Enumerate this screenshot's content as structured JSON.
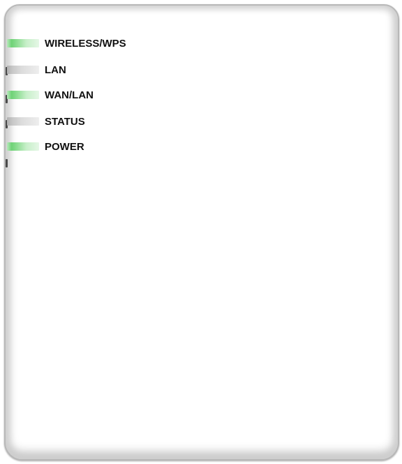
{
  "indicators": [
    {
      "label": "WIRELESS/WPS",
      "state": "on",
      "color": "#6fd277"
    },
    {
      "label": "LAN",
      "state": "off",
      "color": "#c8c8c8"
    },
    {
      "label": "WAN/LAN",
      "state": "on",
      "color": "#6fd277"
    },
    {
      "label": "STATUS",
      "state": "off",
      "color": "#c8c8c8"
    },
    {
      "label": "POWER",
      "state": "on",
      "color": "#6fd277"
    }
  ]
}
